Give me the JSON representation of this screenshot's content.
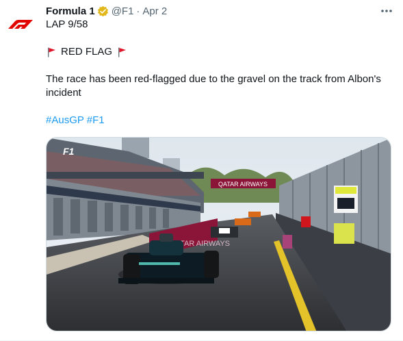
{
  "tweet": {
    "author_name": "Formula 1",
    "verified_icon": "gold-check-badge-icon",
    "handle": "@F1",
    "separator": "·",
    "time": "Apr 2",
    "more_icon": "more-dots-icon",
    "line1": "LAP 9/58",
    "red_flag_icon": "triangular-red-flag-icon",
    "line2": "RED FLAG",
    "line3": "The race has been red-flagged due to the gravel on the track from Albon's incident",
    "hashtags": [
      "#AusGP",
      "#F1"
    ],
    "media": {
      "description_icon": "race-photo",
      "banner_text": "QATAR AIRWAYS",
      "wall_text": "QATAR AIRWAYS",
      "broadcast_logo": "F1"
    },
    "colors": {
      "brand_red": "#e10600",
      "link_blue": "#1d9bf0",
      "verified_gold": "#e2b719"
    }
  }
}
